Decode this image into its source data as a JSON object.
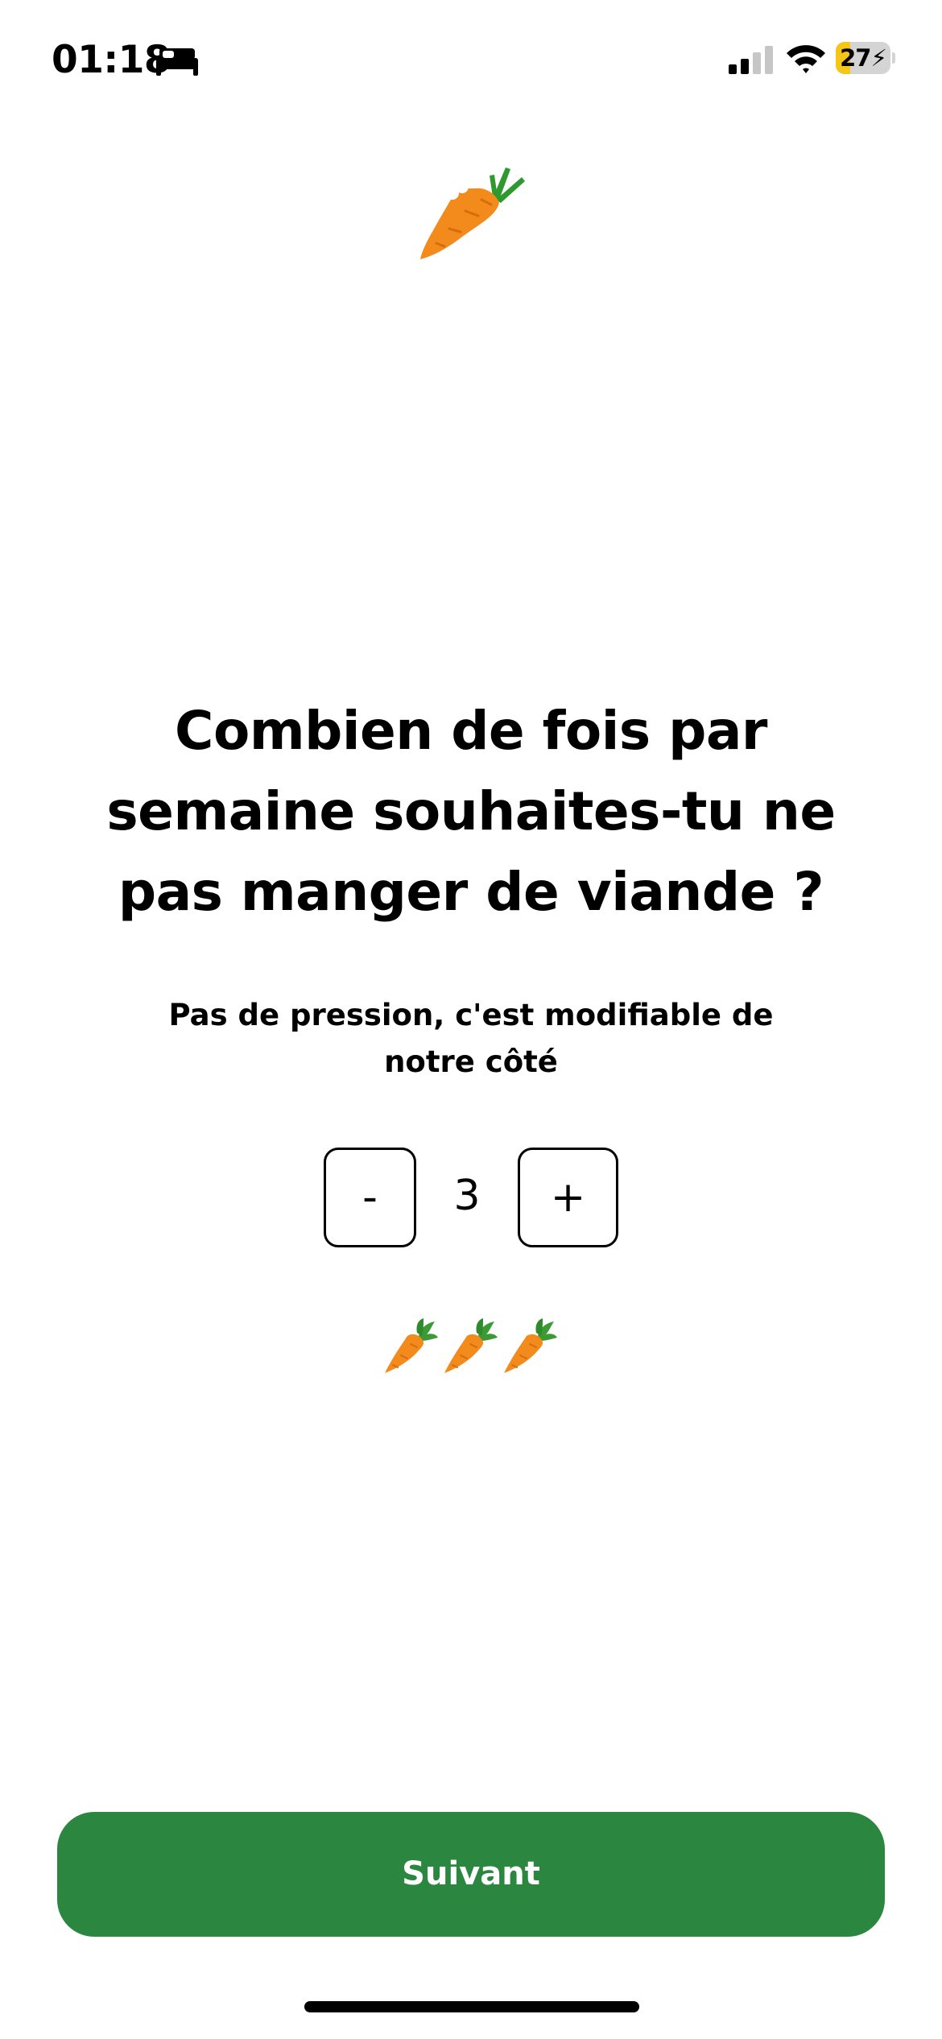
{
  "status_bar": {
    "time": "01:18",
    "battery_percent": "27",
    "battery_level": 0.27,
    "icons": [
      "bed-icon",
      "cellular-signal-icon",
      "wifi-icon",
      "battery-charging-icon"
    ]
  },
  "hero": {
    "icon": "carrot-icon"
  },
  "question": {
    "title": "Combien de fois par semaine souhaites-tu ne pas manger de viande ?",
    "subtitle": "Pas de pression, c'est modifiable de notre côté"
  },
  "stepper": {
    "decrement_label": "-",
    "value": "3",
    "increment_label": "+"
  },
  "carrot_row": {
    "count": 3,
    "icon": "carrot-icon"
  },
  "footer": {
    "next_label": "Suivant"
  },
  "colors": {
    "primary_button": "#2b8640",
    "battery_fill": "#f5c518",
    "carrot_orange": "#f28a1c",
    "carrot_leaf": "#2e9a2e"
  }
}
